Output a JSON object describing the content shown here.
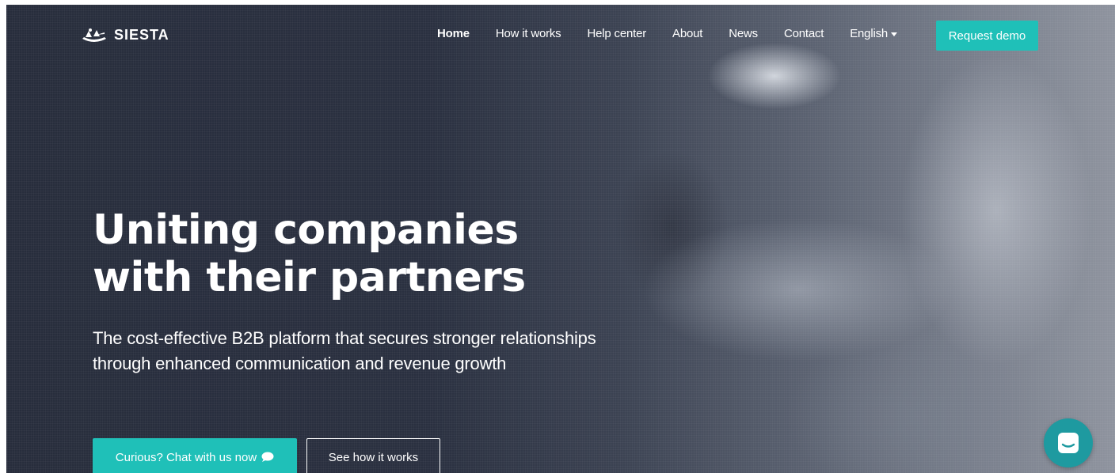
{
  "brand": {
    "name": "SIESTA",
    "logo_icon": "hammock-logo-icon"
  },
  "nav": {
    "items": [
      {
        "label": "Home",
        "active": true
      },
      {
        "label": "How it works"
      },
      {
        "label": "Help center"
      },
      {
        "label": "About"
      },
      {
        "label": "News"
      },
      {
        "label": "Contact"
      }
    ],
    "language": "English",
    "cta": "Request demo"
  },
  "hero": {
    "headline_line1": "Uniting companies",
    "headline_line2": "with their partners",
    "subtext": "The cost-effective B2B platform that secures stronger relationships through enhanced communication and revenue growth",
    "primary_button": "Curious? Chat with us now",
    "primary_button_icon": "speech-bubble-icon",
    "secondary_button": "See how it works"
  },
  "chat_widget": {
    "icon": "chat-launcher-icon"
  },
  "colors": {
    "accent": "#1fc0b8",
    "chat_widget": "#1e9aa0",
    "hero_dark": "#272d3c",
    "text": "#ffffff"
  }
}
